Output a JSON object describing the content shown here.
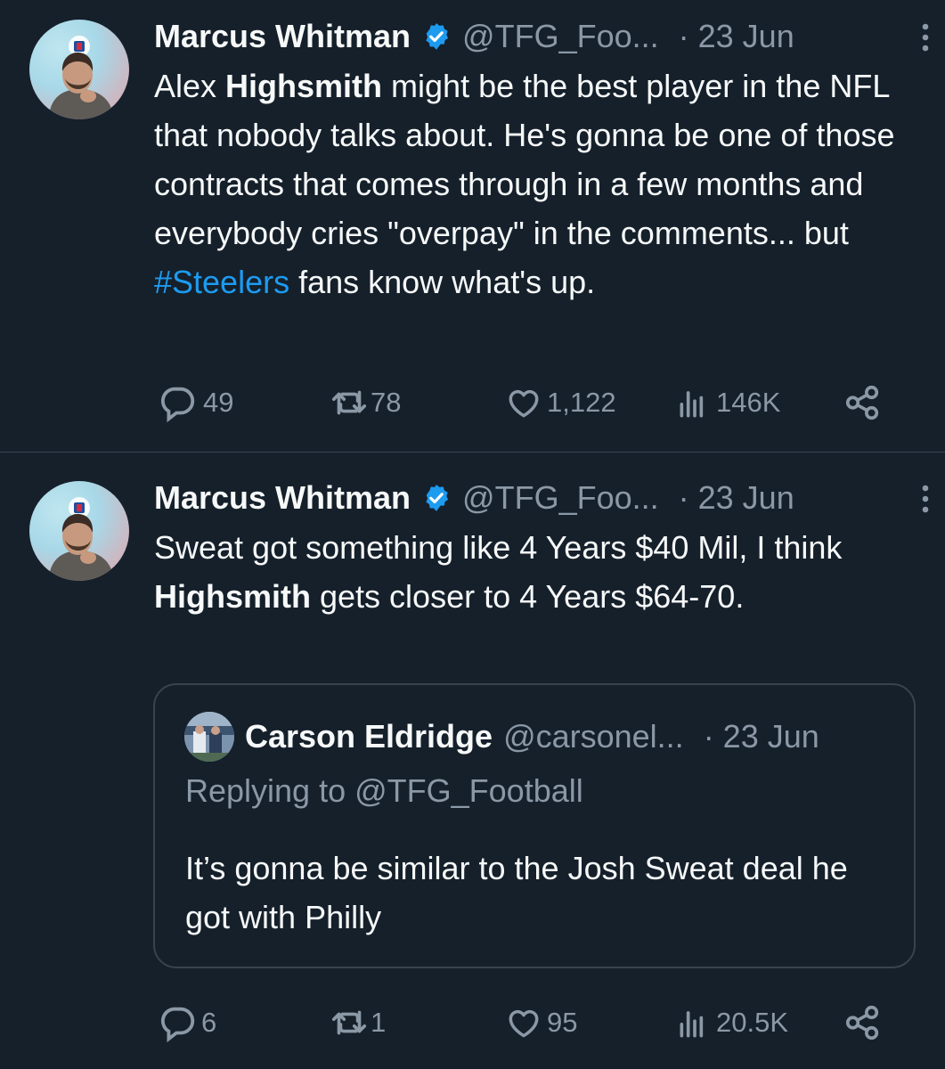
{
  "tweets": [
    {
      "author_name": "Marcus Whitman",
      "handle": "@TFG_Foo...",
      "date": "· 23 Jun",
      "text_segments": [
        "Alex ",
        "Highsmith",
        " might be the best player in the NFL that nobody talks about. He's gonna be one of those contracts that comes through in a few months and everybody cries \"overpay\" in the comments... but ",
        "#Steelers",
        " fans know what's up."
      ],
      "replies": "49",
      "retweets": "78",
      "likes": "1,122",
      "views": "146K"
    },
    {
      "author_name": "Marcus Whitman",
      "handle": "@TFG_Foo...",
      "date": "· 23 Jun",
      "text_segments": [
        "Sweat got something like 4 Years $40 Mil, I think ",
        "Highsmith",
        " gets closer to 4 Years $64-70."
      ],
      "replies": "6",
      "retweets": "1",
      "likes": "95",
      "views": "20.5K",
      "quote": {
        "author_name": "Carson Eldridge",
        "handle": "@carsonel...",
        "date": "· 23 Jun",
        "replying_to": "Replying to @TFG_Football",
        "text": "It’s gonna be similar to the Josh Sweat deal he got with Philly"
      }
    }
  ],
  "icons": {
    "verified": "verified-badge-icon",
    "more": "more-vertical-icon",
    "reply": "reply-icon",
    "retweet": "retweet-icon",
    "like": "heart-icon",
    "views": "views-chart-icon",
    "share": "share-icon"
  },
  "colors": {
    "background": "#15202b",
    "text": "#f7f9f9",
    "secondary": "#8b98a5",
    "accent": "#1d9bf0",
    "border": "#38444d"
  }
}
